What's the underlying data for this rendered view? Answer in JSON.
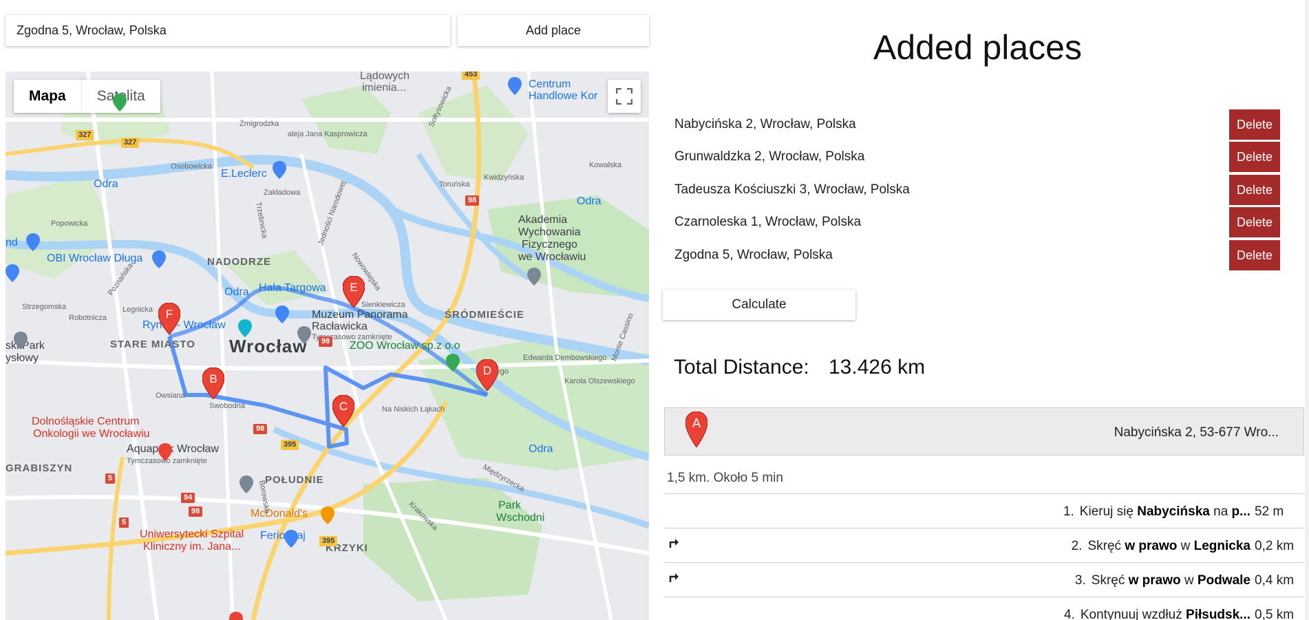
{
  "search": {
    "value": "Zgodna 5, Wrocław, Polska"
  },
  "add_button": "Add place",
  "map": {
    "type_control": [
      "Mapa",
      "Satelita"
    ],
    "active_type": "Mapa",
    "labels": {
      "ladowych": "Lądowych",
      "imienia": "imienia...",
      "centrum": "Centrum",
      "handlowe": "Handlowe Kor",
      "leclerc": "E.Leclerc",
      "odra": "Odra",
      "popowicka": "Popowicka",
      "osobowicka": "Osobowicka",
      "kasprowicza": "aleja Jana Kasprowicza",
      "zmigrodzka": "Żmigrodzka",
      "zakladowa": "Zakładowa",
      "torunska": "Toruńska",
      "kwidzynska": "Kwidzyńska",
      "kowalska": "Kowalska",
      "akademia1": "Akademia",
      "akademia2": "Wychowania",
      "akademia3": "Fizycznego",
      "akademia4": "we Wrocławiu",
      "obi": "OBI Wrocław Długa",
      "nd": "nd",
      "nadodrze": "NADODRZE",
      "hala": "Hala Targowa",
      "muzeum1": "Muzeum Panorama",
      "muzeum2": "Racławicka",
      "muzeum3": "Tymczasowo zamknięte",
      "srodmiescie": "ŚRÓDMIEŚCIE",
      "rynek": "Rynek - Wrocław",
      "stare": "STARE MIASTO",
      "wroclaw": "Wrocław",
      "zoo": "ZOO Wrocław sp.z o.o",
      "park1": "ski Park",
      "park2": "ysłowy",
      "strzegomska": "Strzegomska",
      "robotnicza": "Robotnicza",
      "legnicka": "Legnicka",
      "owsiana": "Owsiana",
      "swobodna": "Swobodna",
      "dembowskiego": "Edwarda Dembowskiego",
      "olszewskiego": "Karola Olszewskiego",
      "nanisk": "Na Niskich Łąkach",
      "dolno1": "Dolnośląskie Centrum",
      "dolno2": "Onkologii we Wrocławiu",
      "aquapark1": "Aquapark Wrocław",
      "aquapark2": "Tymczasowo zamknięte",
      "grabiszyn": "GRABISZYN",
      "poludnie": "POŁUDNIE",
      "mcdonalds": "McDonald's",
      "park_w1": "Park",
      "park_w2": "Wschodni",
      "szpital1": "Uniwersytecki Szpital",
      "szpital2": "Kliniczny im. Jana...",
      "ferio": "Ferio Gaj",
      "krzyki": "KRZYKI",
      "borowska": "Borowska",
      "krakowska": "Krakowska",
      "miedzyrzecka": "Międzyrzecka",
      "nowowiejska": "Nowowiejska",
      "sienkiewicza": "Sienkiewicza",
      "jednosci": "Jedności Narodowej",
      "trzebnicka": "Trzebnicka",
      "poznanska": "Poznańska",
      "monte": "Monte Cassino",
      "sobieskiego": "Sołtysowicka",
      "ewskiego": "ewskiego"
    },
    "shields": [
      "453",
      "327",
      "327",
      "98",
      "98",
      "98",
      "395",
      "395",
      "94",
      "98",
      "5",
      "5",
      "98"
    ],
    "markers": [
      "A",
      "B",
      "C",
      "D",
      "E",
      "F"
    ]
  },
  "right": {
    "title": "Added places",
    "places": [
      "Nabycińska 2, Wrocław, Polska",
      "Grunwaldzka 2, Wrocław, Polska",
      "Tadeusza Kościuszki 3, Wrocław, Polska",
      "Czarnoleska 1, Wrocław, Polska",
      "Zgodna 5, Wrocław, Polska"
    ],
    "delete_label": "Delete",
    "calculate_label": "Calculate",
    "total_label": "Total Distance:",
    "total_value": "13.426 km",
    "step_header": {
      "marker": "A",
      "address": "Nabycińska 2, 53-677 Wro..."
    },
    "leg_summary": "1,5 km. Około 5 min",
    "steps": [
      {
        "num": "1.",
        "a": "Kieruj się ",
        "b": "Nabycińska",
        "c": " na ",
        "d": "p...",
        "dist": "52 m",
        "icon": ""
      },
      {
        "num": "2.",
        "a": "Skręć ",
        "b": "w prawo",
        "c": " w ",
        "d": "Legnicka",
        "dist": "0,2 km",
        "icon": "turn-right-icon"
      },
      {
        "num": "3.",
        "a": "Skręć ",
        "b": "w prawo",
        "c": " w ",
        "d": "Podwale",
        "dist": "0,4 km",
        "icon": "turn-right-icon"
      },
      {
        "num": "4.",
        "a": "Kontynuuj wzdłuż ",
        "b": "Piłsudsk...",
        "c": "",
        "d": "",
        "dist": "0,5 km",
        "icon": ""
      }
    ]
  },
  "colors": {
    "delete": "#a52a2a",
    "route": "#4285f4",
    "marker": "#ea4335"
  }
}
